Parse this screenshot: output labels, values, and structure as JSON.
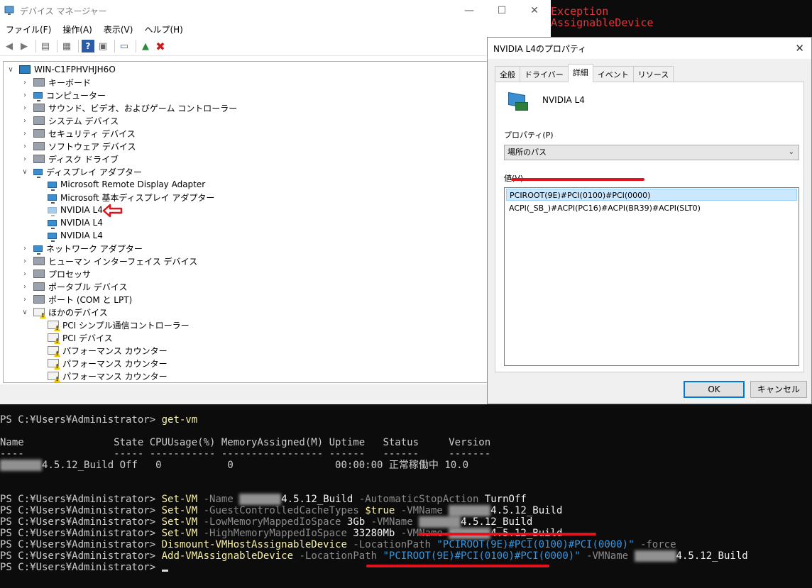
{
  "devmgr": {
    "title": "デバイス マネージャー",
    "menu": [
      "ファイル(F)",
      "操作(A)",
      "表示(V)",
      "ヘルプ(H)"
    ],
    "tree": [
      {
        "label": "WIN-C1FPHVHJH6O",
        "level": 0,
        "expander": "open",
        "icon": "computer-root"
      },
      {
        "label": "キーボード",
        "level": 1,
        "expander": "closed",
        "icon": "keyboard"
      },
      {
        "label": "コンピューター",
        "level": 1,
        "expander": "closed",
        "icon": "monitor"
      },
      {
        "label": "サウンド、ビデオ、およびゲーム コントローラー",
        "level": 1,
        "expander": "closed",
        "icon": "speaker"
      },
      {
        "label": "システム デバイス",
        "level": 1,
        "expander": "closed",
        "icon": "system"
      },
      {
        "label": "セキュリティ デバイス",
        "level": 1,
        "expander": "closed",
        "icon": "security"
      },
      {
        "label": "ソフトウェア デバイス",
        "level": 1,
        "expander": "closed",
        "icon": "software"
      },
      {
        "label": "ディスク ドライブ",
        "level": 1,
        "expander": "closed",
        "icon": "disk"
      },
      {
        "label": "ディスプレイ アダプター",
        "level": 1,
        "expander": "open",
        "icon": "monitor"
      },
      {
        "label": "Microsoft Remote Display Adapter",
        "level": 2,
        "expander": "",
        "icon": "monitor"
      },
      {
        "label": "Microsoft 基本ディスプレイ アダプター",
        "level": 2,
        "expander": "",
        "icon": "monitor"
      },
      {
        "label": "NVIDIA L4",
        "level": 2,
        "expander": "",
        "icon": "monitor-disabled",
        "arrow": true
      },
      {
        "label": "NVIDIA L4",
        "level": 2,
        "expander": "",
        "icon": "monitor"
      },
      {
        "label": "NVIDIA L4",
        "level": 2,
        "expander": "",
        "icon": "monitor"
      },
      {
        "label": "ネットワーク アダプター",
        "level": 1,
        "expander": "closed",
        "icon": "monitor"
      },
      {
        "label": "ヒューマン インターフェイス デバイス",
        "level": 1,
        "expander": "closed",
        "icon": "hid"
      },
      {
        "label": "プロセッサ",
        "level": 1,
        "expander": "closed",
        "icon": "processor"
      },
      {
        "label": "ポータブル デバイス",
        "level": 1,
        "expander": "closed",
        "icon": "portable"
      },
      {
        "label": "ポート (COM と LPT)",
        "level": 1,
        "expander": "closed",
        "icon": "port"
      },
      {
        "label": "ほかのデバイス",
        "level": 1,
        "expander": "open",
        "icon": "unknown"
      },
      {
        "label": "PCI シンプル通信コントローラー",
        "level": 2,
        "expander": "",
        "icon": "warning"
      },
      {
        "label": "PCI デバイス",
        "level": 2,
        "expander": "",
        "icon": "warning"
      },
      {
        "label": "パフォーマンス カウンター",
        "level": 2,
        "expander": "",
        "icon": "warning"
      },
      {
        "label": "パフォーマンス カウンター",
        "level": 2,
        "expander": "",
        "icon": "warning"
      },
      {
        "label": "パフォーマンス カウンター",
        "level": 2,
        "expander": "",
        "icon": "warning"
      }
    ]
  },
  "errtext": [
    "Exception",
    "AssignableDevice"
  ],
  "props": {
    "title": "NVIDIA L4のプロパティ",
    "tabs": [
      "全般",
      "ドライバー",
      "詳細",
      "イベント",
      "リソース"
    ],
    "device_name": "NVIDIA L4",
    "property_label": "プロパティ(P)",
    "property_value": "場所のパス",
    "value_label": "値(V)",
    "values": [
      "PCIROOT(9E)#PCI(0100)#PCI(0000)",
      "ACPI(_SB_)#ACPI(PC16)#ACPI(BR39)#ACPI(SLT0)"
    ],
    "ok_label": "OK",
    "cancel_label": "キャンセル"
  },
  "ps": {
    "prompt": "PS C:¥Users¥Administrator>",
    "cmd1": "get-vm",
    "table_header": "Name               State CPUUsage(%) MemoryAssigned(M) Uptime   Status     Version",
    "table_sep": "----               ----- ----------- ----------------- ------   ------     -------",
    "row_name_hidden": "SCOPED ",
    "row_name_tail": "4.5.12_Build",
    "row_rest": " Off   0           0                 00:00:00 正常稼働中 10.0",
    "vm_hidden": "SCOPED ",
    "vm_tail": "4.5.12_Build",
    "lines": [
      {
        "cmd": "Set-VM",
        "param1": "-Name",
        "arg1": "",
        "param2": "-AutomaticStopAction",
        "arg2": "TurnOff"
      },
      {
        "cmd": "Set-VM",
        "param1": "-GuestControlledCacheTypes",
        "arg1": "$true",
        "param2": "-VMName",
        "arg2": ""
      },
      {
        "cmd": "Set-VM",
        "param1": "-LowMemoryMappedIoSpace",
        "arg1": "3Gb",
        "param2": "-VMName",
        "arg2": ""
      },
      {
        "cmd": "Set-VM",
        "param1": "-HighMemoryMappedIoSpace",
        "arg1": "33280Mb",
        "param2": "-VMName",
        "arg2": ""
      }
    ],
    "dismount_cmd": "Dismount-VMHostAssignableDevice",
    "add_cmd": "Add-VMAssignableDevice",
    "location_param": "-LocationPath",
    "location_value": "\"PCIROOT(9E)#PCI(0100)#PCI(0000)\"",
    "force_param": "-force",
    "vmname_param": "-VMName"
  }
}
